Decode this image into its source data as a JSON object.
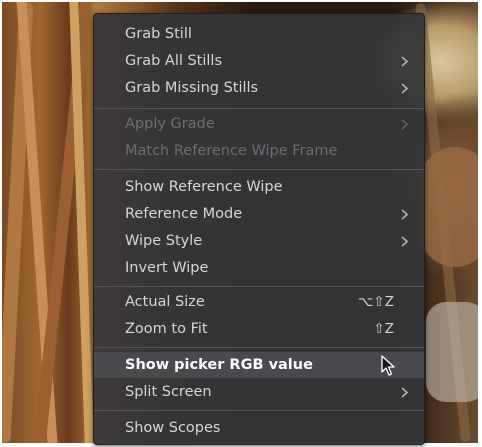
{
  "menu": {
    "items": [
      {
        "label": "Grab Still",
        "submenu": false,
        "enabled": true
      },
      {
        "label": "Grab All Stills",
        "submenu": true,
        "enabled": true
      },
      {
        "label": "Grab Missing Stills",
        "submenu": true,
        "enabled": true
      },
      {
        "label": "Apply Grade",
        "submenu": true,
        "enabled": false
      },
      {
        "label": "Match Reference Wipe Frame",
        "submenu": false,
        "enabled": false
      },
      {
        "label": "Show Reference Wipe",
        "submenu": false,
        "enabled": true
      },
      {
        "label": "Reference Mode",
        "submenu": true,
        "enabled": true
      },
      {
        "label": "Wipe Style",
        "submenu": true,
        "enabled": true
      },
      {
        "label": "Invert Wipe",
        "submenu": false,
        "enabled": true
      },
      {
        "label": "Actual Size",
        "shortcut": "⌥⇧Z",
        "enabled": true
      },
      {
        "label": "Zoom to Fit",
        "shortcut": "⇧Z",
        "enabled": true
      },
      {
        "label": "Show picker RGB value",
        "submenu": false,
        "enabled": true,
        "highlighted": true
      },
      {
        "label": "Split Screen",
        "submenu": true,
        "enabled": true
      },
      {
        "label": "Show Scopes",
        "submenu": false,
        "enabled": true
      }
    ]
  },
  "colors": {
    "menu_bg": "#343437",
    "highlight_bg": "#4a4a4e",
    "text": "#d6d6d8",
    "disabled_text": "#6e6e72"
  }
}
